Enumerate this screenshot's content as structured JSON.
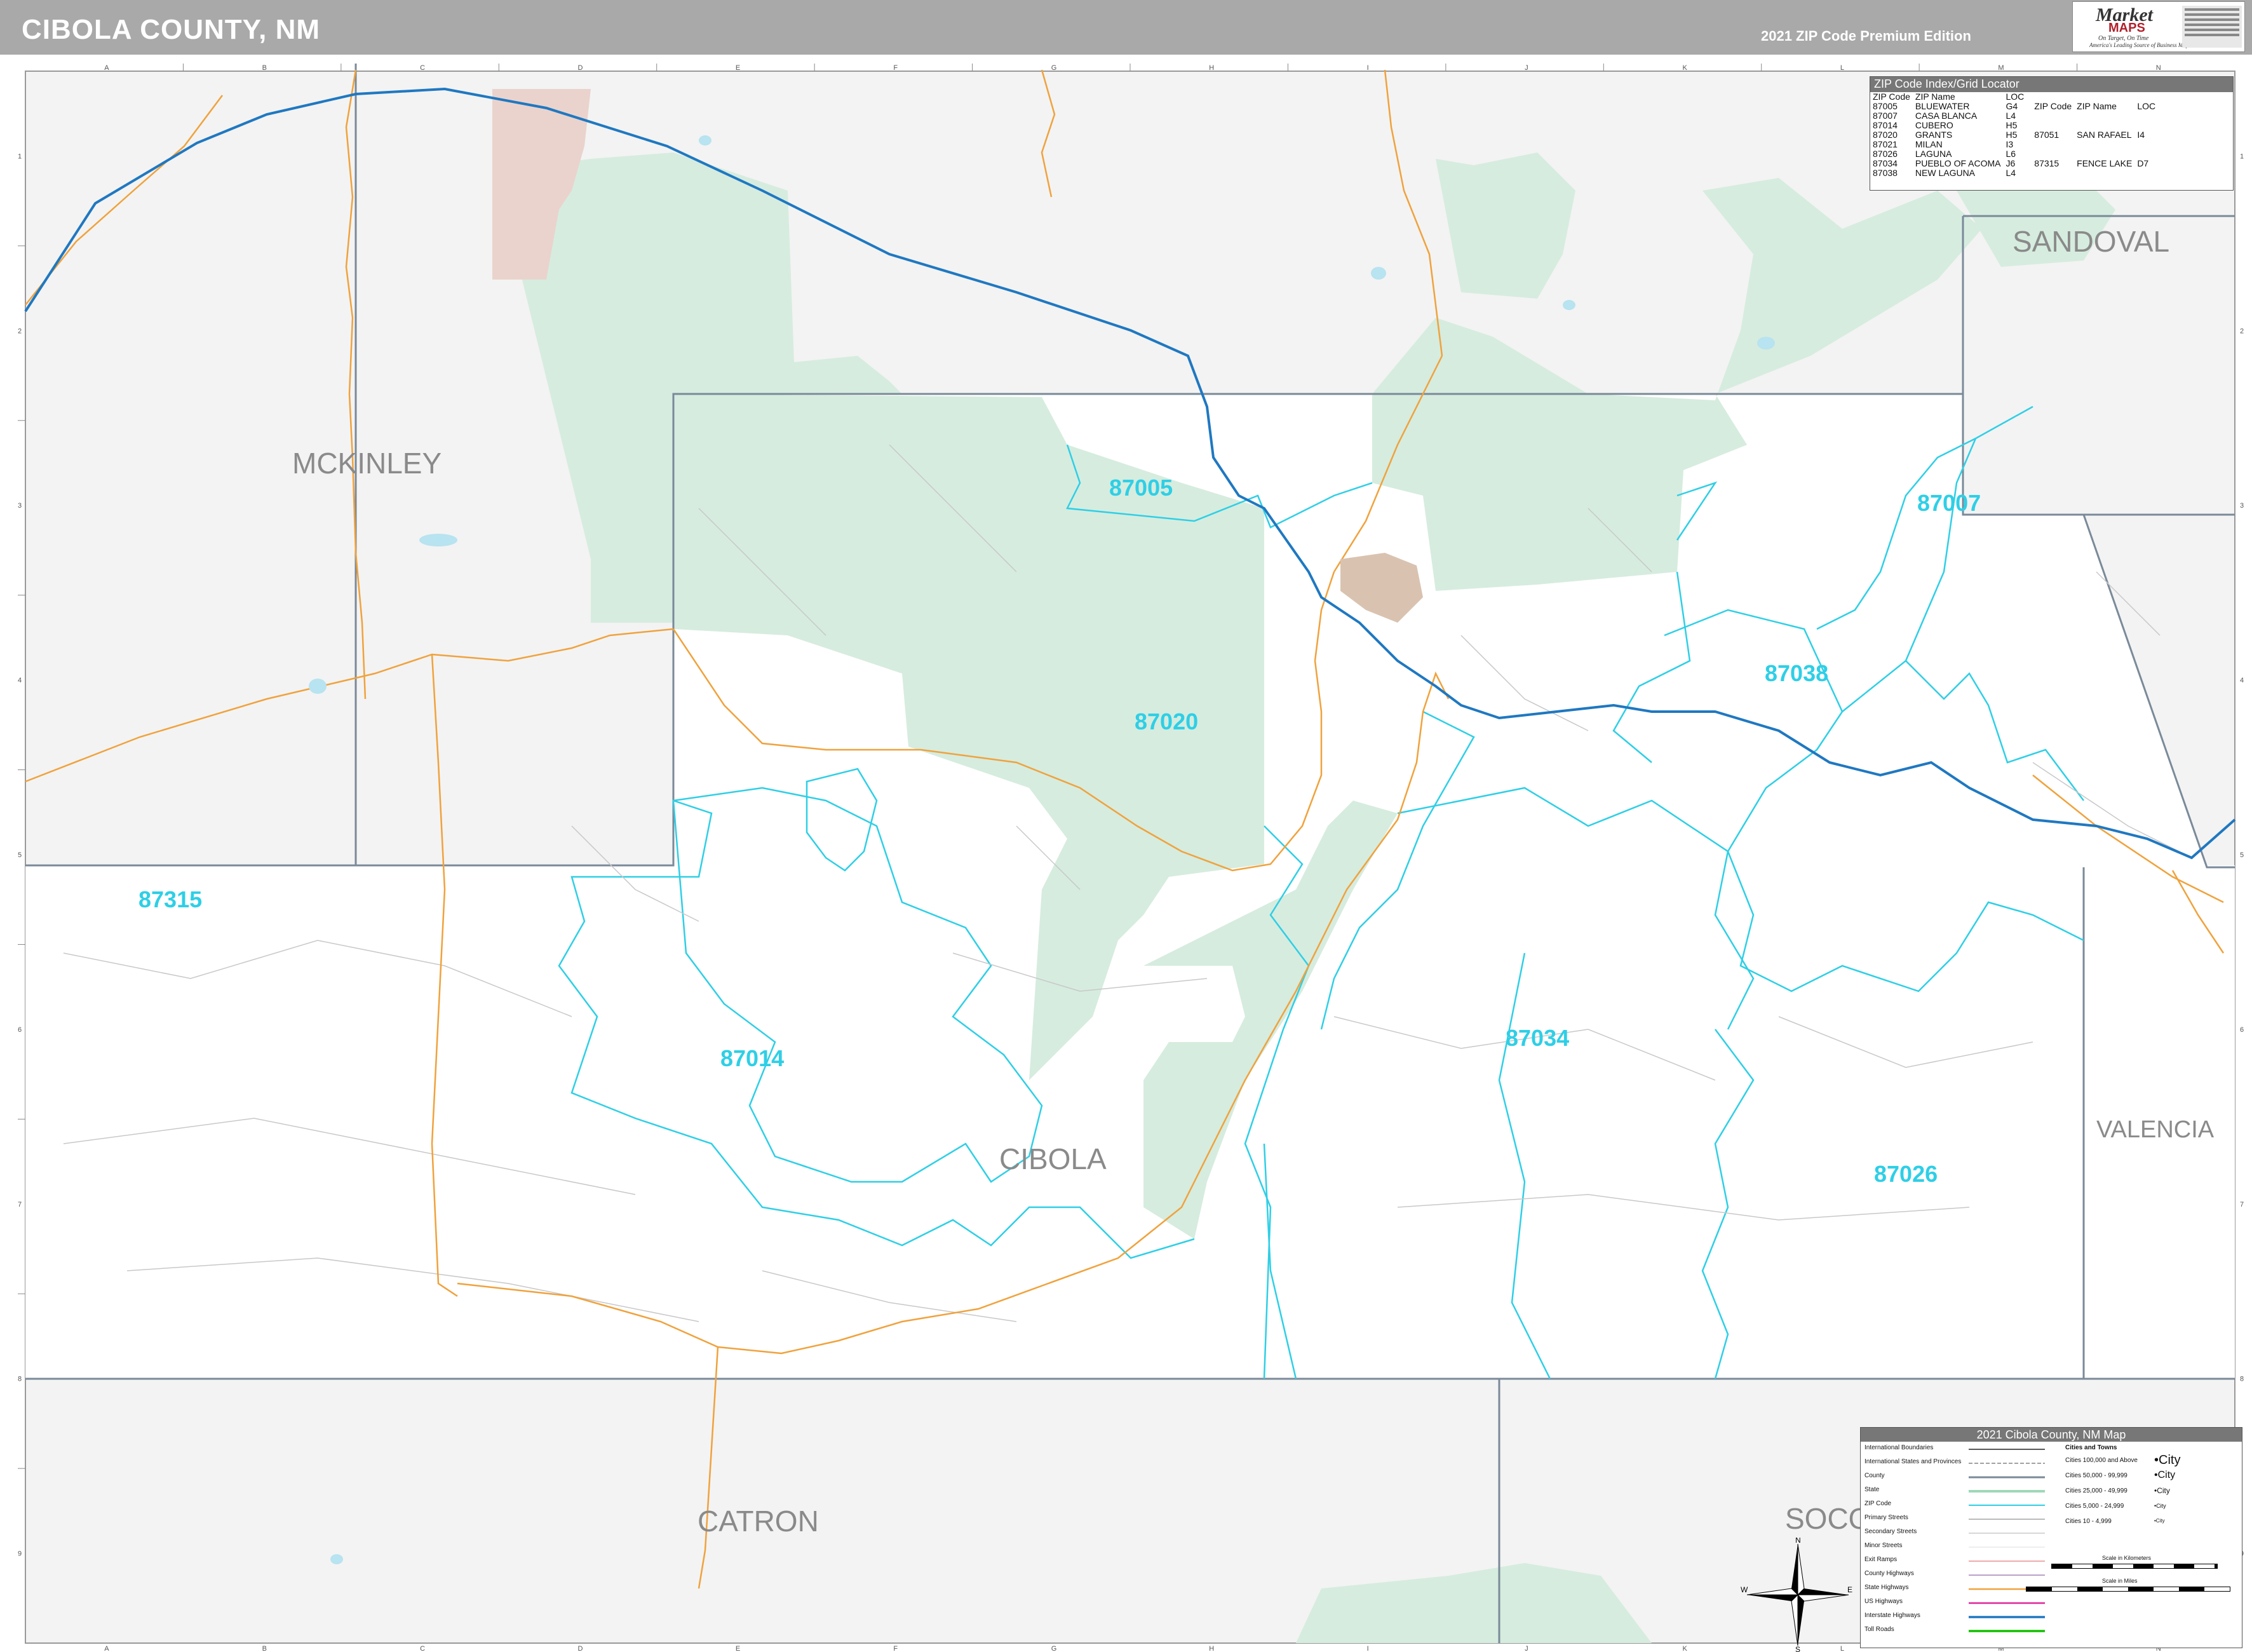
{
  "header": {
    "title": "CIBOLA COUNTY, NM",
    "edition": "2021 ZIP Code Premium Edition"
  },
  "logo": {
    "brand_line1": "Market",
    "brand_line2": "MAPS",
    "tagline1": "On Target, On Time",
    "tagline2": "America's Leading Source of Business Maps"
  },
  "grid": {
    "columns": [
      "A",
      "B",
      "C",
      "D",
      "E",
      "F",
      "G",
      "H",
      "I",
      "J",
      "K",
      "L",
      "M",
      "N"
    ],
    "rows": [
      "1",
      "2",
      "3",
      "4",
      "5",
      "6",
      "7",
      "8",
      "9"
    ]
  },
  "counties": {
    "mckinley": "MCKINLEY",
    "sandoval": "SANDOVAL",
    "cibola": "CIBOLA",
    "valencia": "VALENCIA",
    "catron": "CATRON",
    "socorro": "SOCO"
  },
  "zip_labels": {
    "z87005": "87005",
    "z87007": "87007",
    "z87020": "87020",
    "z87038": "87038",
    "z87315": "87315",
    "z87014": "87014",
    "z87034": "87034",
    "z87026": "87026"
  },
  "colors": {
    "background_outside": "#f3f3f3",
    "county_fill": "#ffffff",
    "forest": "#d6ecdf",
    "reservation": "#ead3cd",
    "interstate": "#1f78c1",
    "state_highway": "#f0a23c",
    "zip_boundary": "#2ecfe6",
    "county_boundary": "#7a8a99"
  },
  "zip_index": {
    "title": "ZIP Code Index/Grid Locator",
    "headers": [
      "ZIP Code",
      "ZIP Name",
      "LOC",
      "ZIP Code",
      "ZIP Name",
      "LOC"
    ],
    "left": [
      [
        "87005",
        "BLUEWATER",
        "G4"
      ],
      [
        "87007",
        "CASA BLANCA",
        "L4"
      ],
      [
        "87014",
        "CUBERO",
        "H5"
      ],
      [
        "87020",
        "GRANTS",
        "H5"
      ],
      [
        "87021",
        "MILAN",
        "I3"
      ],
      [
        "87026",
        "LAGUNA",
        "L6"
      ],
      [
        "87034",
        "PUEBLO OF ACOMA",
        "J6"
      ],
      [
        "87038",
        "NEW LAGUNA",
        "L4"
      ]
    ],
    "right": [
      [
        "87051",
        "SAN RAFAEL",
        "I4"
      ],
      [
        "87315",
        "FENCE LAKE",
        "D7"
      ]
    ]
  },
  "legend": {
    "title": "2021 Cibola County, NM Map",
    "left_items": [
      "International Boundaries",
      "International States and Provinces",
      "County",
      "State",
      "ZIP Code",
      "Primary Streets",
      "Secondary Streets",
      "Minor Streets",
      "Exit Ramps",
      "County Highways",
      "State Highways",
      "US Highways",
      "Interstate Highways",
      "Toll Roads"
    ],
    "right_header": "Cities and Towns",
    "right_items": [
      [
        "Cities 100,000 and Above",
        "•City"
      ],
      [
        "Cities 50,000 - 99,999",
        "•City"
      ],
      [
        "Cities 25,000 - 49,999",
        "•City"
      ],
      [
        "Cities 5,000 - 24,999",
        "•City"
      ],
      [
        "Cities 10 - 4,999",
        "•City"
      ]
    ],
    "scale_km": "Scale in Kilometers",
    "scale_mi": "Scale in Miles"
  },
  "compass": {
    "n": "N",
    "s": "S",
    "e": "E",
    "w": "W"
  }
}
